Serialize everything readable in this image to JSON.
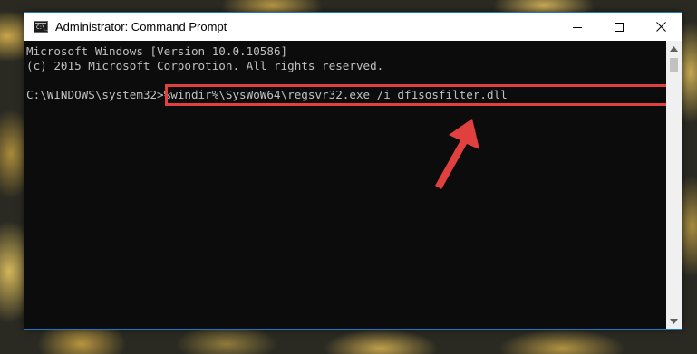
{
  "window": {
    "title": "Administrator: Command Prompt",
    "icon": "cmd-icon",
    "icon_glyph": "C:\\_"
  },
  "controls": {
    "minimize_icon": "minimize-icon",
    "maximize_icon": "maximize-icon",
    "close_icon": "close-icon"
  },
  "console": {
    "background": "#0c0c0c",
    "text_color": "#c0c0c0",
    "lines": [
      "Microsoft Windows [Version 10.0.10586]",
      "(c) 2015 Microsoft Corporotion. All rights reserved.",
      "",
      "C:\\WINDOWS\\system32>%windir%\\SysWoW64\\regsvr32.exe /i df1sosfilter.dll"
    ]
  },
  "annotation": {
    "highlight_color": "#e0413f",
    "arrow_icon": "red-arrow-icon"
  }
}
